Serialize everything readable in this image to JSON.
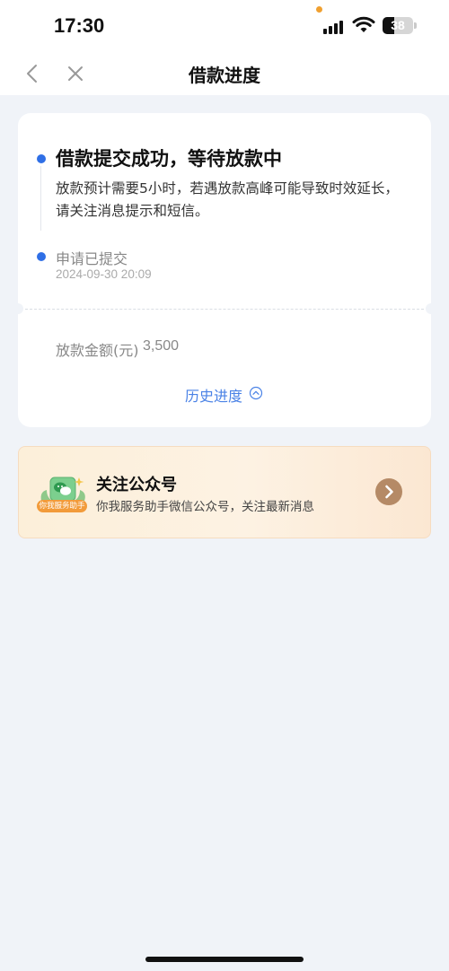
{
  "status_bar": {
    "time": "17:30",
    "battery_level": "38",
    "icons": [
      "signal-icon",
      "wifi-icon",
      "battery-icon"
    ]
  },
  "nav": {
    "title": "借款进度",
    "icons": [
      "back-arrow-icon",
      "close-icon"
    ]
  },
  "progress": {
    "steps": [
      {
        "title": "借款提交成功，等待放款中",
        "description": "放款预计需要5小时，若遇放款高峰可能导致时效延长，请关注消息提示和短信。"
      },
      {
        "title": "申请已提交",
        "time": "2024-09-30 20:09"
      }
    ],
    "amount_label": "放款金额(元)",
    "amount_value": "3,500",
    "history_label": "历史进度"
  },
  "banner": {
    "title": "关注公众号",
    "description": "你我服务助手微信公众号，关注最新消息",
    "badge": "你我服务助手",
    "icon": "wechat-icon"
  },
  "colors": {
    "accent_blue": "#2f6fe6",
    "link_blue": "#4a82e6",
    "background": "#f0f3f8",
    "banner_arrow": "#b58a66",
    "status_orange": "#f0a030"
  }
}
